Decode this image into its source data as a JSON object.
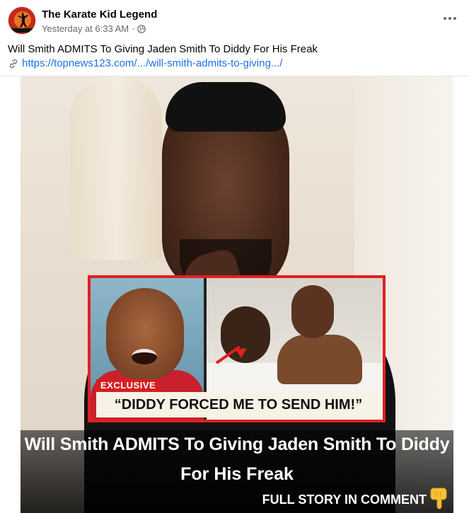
{
  "post": {
    "page_name": "The Karate Kid Legend",
    "timestamp": "Yesterday at 6:33 AM",
    "separator": "·",
    "privacy_icon": "globe-icon",
    "more_icon": "more-options-icon",
    "text": "Will Smith ADMITS To Giving Jaden Smith To Diddy For His Freak",
    "link_icon": "link-icon",
    "link": "https://topnews123.com/.../will-smith-admits-to-giving.../"
  },
  "image": {
    "exclusive_label": "EXCLUSIVE",
    "quote": "“DIDDY FORCED ME TO SEND HIM!”",
    "headline_line1": "Will Smith ADMITS To Giving Jaden Smith To Diddy",
    "headline_line2": "For His Freak",
    "cta": "FULL STORY IN COMMENT",
    "cta_icon": "pointing-down-hand-icon"
  },
  "colors": {
    "link": "#1b74e4",
    "muted": "#65676b",
    "accent_red": "#e02020"
  }
}
